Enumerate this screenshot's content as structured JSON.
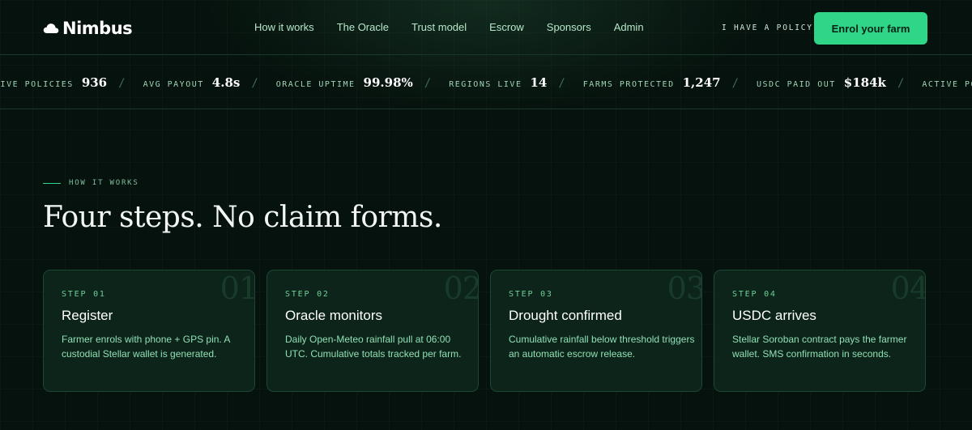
{
  "brand": {
    "name": "Nimbus",
    "icon": "cloud-icon"
  },
  "nav": {
    "links": [
      "How it works",
      "The Oracle",
      "Trust model",
      "Escrow",
      "Sponsors",
      "Admin"
    ],
    "policy_label": "I HAVE A POLICY",
    "cta_label": "Enrol your farm"
  },
  "ticker": {
    "stats": [
      {
        "label": "ACTIVE POLICIES",
        "value": "936"
      },
      {
        "label": "AVG PAYOUT",
        "value": "4.8s"
      },
      {
        "label": "ORACLE UPTIME",
        "value": "99.98%"
      },
      {
        "label": "REGIONS LIVE",
        "value": "14"
      },
      {
        "label": "FARMS PROTECTED",
        "value": "1,247"
      },
      {
        "label": "USDC PAID OUT",
        "value": "$184k"
      },
      {
        "label": "ACTIVE POLICIES",
        "value": "936"
      }
    ],
    "separator": "/"
  },
  "section": {
    "eyebrow": "HOW IT WORKS",
    "heading": "Four steps. No claim forms.",
    "steps": [
      {
        "number": "01",
        "label": "STEP 01",
        "title": "Register",
        "desc": "Farmer enrols with phone + GPS pin. A custodial Stellar wallet is generated."
      },
      {
        "number": "02",
        "label": "STEP 02",
        "title": "Oracle monitors",
        "desc": "Daily Open-Meteo rainfall pull at 06:00 UTC. Cumulative totals tracked per farm."
      },
      {
        "number": "03",
        "label": "STEP 03",
        "title": "Drought confirmed",
        "desc": "Cumulative rainfall below threshold triggers an automatic escrow release."
      },
      {
        "number": "04",
        "label": "STEP 04",
        "title": "USDC arrives",
        "desc": "Stellar Soroban contract pays the farmer wallet. SMS confirmation in seconds."
      }
    ]
  },
  "colors": {
    "accent": "#2fd687",
    "background": "#06120d",
    "card": "#0c2419"
  }
}
